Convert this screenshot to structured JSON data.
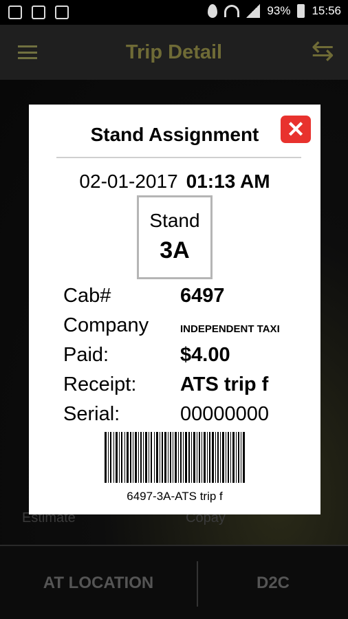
{
  "status_bar": {
    "battery": "93%",
    "time": "15:56"
  },
  "app_bar": {
    "title": "Trip Detail"
  },
  "background": {
    "estimate_label": "Estimate",
    "copay_label": "Copay"
  },
  "bottom_bar": {
    "at_location_label": "AT LOCATION",
    "d2c_label": "D2C"
  },
  "modal": {
    "title": "Stand Assignment",
    "close_glyph": "✕",
    "date": "02-01-2017",
    "time": "01:13 AM",
    "stand_label": "Stand",
    "stand_value": "3A",
    "rows": [
      {
        "label": "Cab#",
        "value": "6497"
      },
      {
        "label": "Company",
        "value": "INDEPENDENT TAXI"
      },
      {
        "label": "Paid:",
        "value": "$4.00"
      },
      {
        "label": "Receipt:",
        "value": "ATS trip f"
      },
      {
        "label": "Serial:",
        "value": "00000000"
      }
    ],
    "barcode_text": "6497-3A-ATS trip f"
  },
  "colors": {
    "close_button": "#e8322e",
    "app_title": "#6f6b36"
  },
  "icons": {
    "menu": "menu-icon",
    "swap": "swap-arrows-icon",
    "close": "close-icon",
    "barcode": "barcode-icon"
  }
}
